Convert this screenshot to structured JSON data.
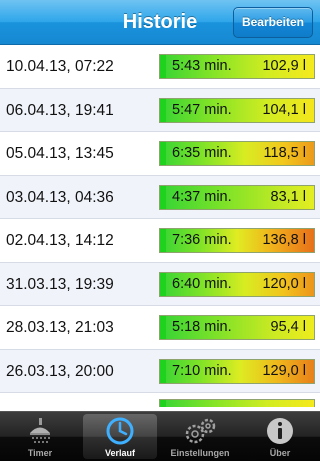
{
  "header": {
    "title": "Historie",
    "edit_label": "Bearbeiten"
  },
  "rows": [
    {
      "date": "10.04.13, 07:22",
      "duration": "5:43 min.",
      "volume": "102,9 l"
    },
    {
      "date": "06.04.13, 19:41",
      "duration": "5:47 min.",
      "volume": "104,1 l"
    },
    {
      "date": "05.04.13, 13:45",
      "duration": "6:35 min.",
      "volume": "118,5 l"
    },
    {
      "date": "03.04.13, 04:36",
      "duration": "4:37 min.",
      "volume": "83,1 l"
    },
    {
      "date": "02.04.13, 14:12",
      "duration": "7:36 min.",
      "volume": "136,8 l"
    },
    {
      "date": "31.03.13, 19:39",
      "duration": "6:40 min.",
      "volume": "120,0 l"
    },
    {
      "date": "28.03.13, 21:03",
      "duration": "5:18 min.",
      "volume": "95,4 l"
    },
    {
      "date": "26.03.13, 20:00",
      "duration": "7:10 min.",
      "volume": "129,0 l"
    }
  ],
  "tabs": [
    {
      "label": "Timer",
      "icon": "shower-icon",
      "active": false
    },
    {
      "label": "Verlauf",
      "icon": "clock-icon",
      "active": true
    },
    {
      "label": "Einstellungen",
      "icon": "gears-icon",
      "active": false
    },
    {
      "label": "Über",
      "icon": "info-icon",
      "active": false
    }
  ],
  "colors": {
    "header": "#2ea6ea",
    "bar_start": "#1ed21e",
    "bar_mid": "#f5f01e",
    "bar_end": "#e8701a"
  }
}
